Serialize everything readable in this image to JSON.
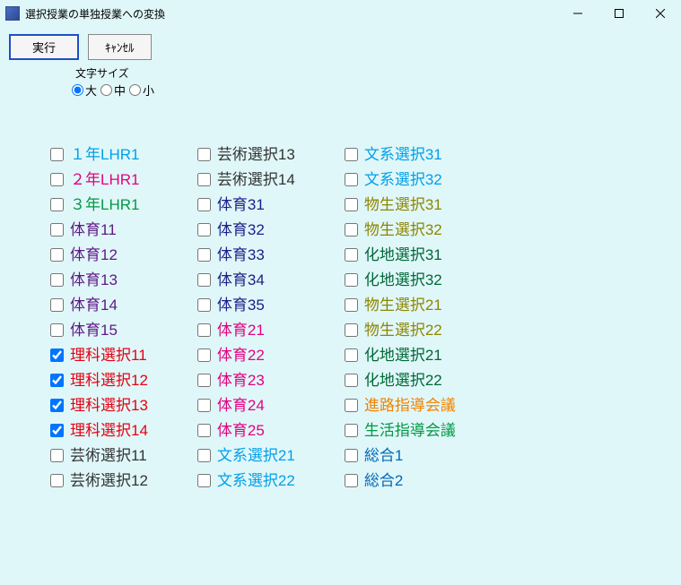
{
  "window": {
    "title": "選択授業の単独授業への変換"
  },
  "toolbar": {
    "execute": "実行",
    "cancel": "ｷｬﾝｾﾙ"
  },
  "fontSize": {
    "groupLabel": "文字サイズ",
    "options": [
      "大",
      "中",
      "小"
    ],
    "selected": "大"
  },
  "columns": [
    [
      {
        "label": "１年LHR1",
        "color": "#00a0e9",
        "checked": false
      },
      {
        "label": "２年LHR1",
        "color": "#e4007f",
        "checked": false
      },
      {
        "label": "３年LHR1",
        "color": "#009944",
        "checked": false
      },
      {
        "label": "体育11",
        "color": "#601986",
        "checked": false
      },
      {
        "label": "体育12",
        "color": "#601986",
        "checked": false
      },
      {
        "label": "体育13",
        "color": "#601986",
        "checked": false
      },
      {
        "label": "体育14",
        "color": "#601986",
        "checked": false
      },
      {
        "label": "体育15",
        "color": "#601986",
        "checked": false
      },
      {
        "label": "理科選択11",
        "color": "#e60012",
        "checked": true
      },
      {
        "label": "理科選択12",
        "color": "#e60012",
        "checked": true
      },
      {
        "label": "理科選択13",
        "color": "#e60012",
        "checked": true
      },
      {
        "label": "理科選択14",
        "color": "#e60012",
        "checked": true
      },
      {
        "label": "芸術選択11",
        "color": "#333333",
        "checked": false
      },
      {
        "label": "芸術選択12",
        "color": "#333333",
        "checked": false
      }
    ],
    [
      {
        "label": "芸術選択13",
        "color": "#333333",
        "checked": false
      },
      {
        "label": "芸術選択14",
        "color": "#333333",
        "checked": false
      },
      {
        "label": "体育31",
        "color": "#1d2088",
        "checked": false
      },
      {
        "label": "体育32",
        "color": "#1d2088",
        "checked": false
      },
      {
        "label": "体育33",
        "color": "#1d2088",
        "checked": false
      },
      {
        "label": "体育34",
        "color": "#1d2088",
        "checked": false
      },
      {
        "label": "体育35",
        "color": "#1d2088",
        "checked": false
      },
      {
        "label": "体育21",
        "color": "#e4007f",
        "checked": false
      },
      {
        "label": "体育22",
        "color": "#e4007f",
        "checked": false
      },
      {
        "label": "体育23",
        "color": "#e4007f",
        "checked": false
      },
      {
        "label": "体育24",
        "color": "#e4007f",
        "checked": false
      },
      {
        "label": "体育25",
        "color": "#e4007f",
        "checked": false
      },
      {
        "label": "文系選択21",
        "color": "#00a0e9",
        "checked": false
      },
      {
        "label": "文系選択22",
        "color": "#00a0e9",
        "checked": false
      }
    ],
    [
      {
        "label": "文系選択31",
        "color": "#00a0e9",
        "checked": false
      },
      {
        "label": "文系選択32",
        "color": "#00a0e9",
        "checked": false
      },
      {
        "label": "物生選択31",
        "color": "#8f8600",
        "checked": false
      },
      {
        "label": "物生選択32",
        "color": "#8f8600",
        "checked": false
      },
      {
        "label": "化地選択31",
        "color": "#006837",
        "checked": false
      },
      {
        "label": "化地選択32",
        "color": "#006837",
        "checked": false
      },
      {
        "label": "物生選択21",
        "color": "#8f8600",
        "checked": false
      },
      {
        "label": "物生選択22",
        "color": "#8f8600",
        "checked": false
      },
      {
        "label": "化地選択21",
        "color": "#006837",
        "checked": false
      },
      {
        "label": "化地選択22",
        "color": "#006837",
        "checked": false
      },
      {
        "label": "進路指導会議",
        "color": "#f08300",
        "checked": false
      },
      {
        "label": "生活指導会議",
        "color": "#009944",
        "checked": false
      },
      {
        "label": "総合1",
        "color": "#0068b7",
        "checked": false
      },
      {
        "label": "総合2",
        "color": "#0068b7",
        "checked": false
      }
    ]
  ]
}
